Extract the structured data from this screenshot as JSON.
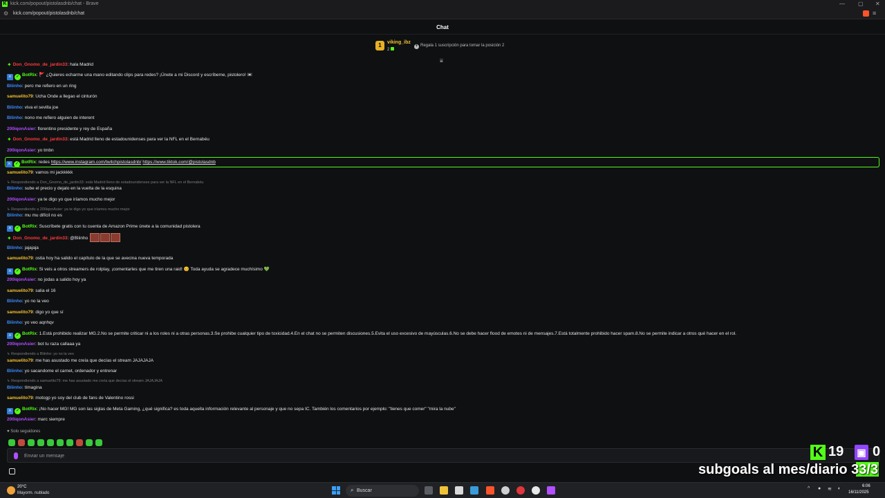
{
  "browser": {
    "title": "kick.com/popout/pistolasdnb/chat - Brave",
    "url": "kick.com/popout/pistolasdnb/chat"
  },
  "header": {
    "title": "Chat"
  },
  "pinned": {
    "rank": "1",
    "gifter_name": "viking_ibz",
    "gifter_count": "2",
    "gift_prompt": "Regala 1 suscripción para tomar la posición 2"
  },
  "colors": {
    "kick_green": "#53fc18",
    "highlight_border": "#53fc18",
    "user_green": "#53fc18",
    "user_blue": "#3d8bff",
    "user_yellow": "#f1c232",
    "user_purple": "#b24fff",
    "user_red": "#ff3b3b"
  },
  "messages": [
    {
      "user": "Don_Gnomo_de_jardin33",
      "text": ": hala Madrid"
    },
    {
      "user": "BotRix",
      "text": ": 🚩 ¿Quieres echarme una mano editando clips para redes? ¡Únete a mi Discord y escríbeme, pistolero! 📼"
    },
    {
      "user": "Bliinho",
      "text": ": pero me refiero en un ring"
    },
    {
      "user": "samuelito79",
      "text": ": Ucha Onde a llegao el cinturón"
    },
    {
      "user": "Bliinho",
      "text": ": viva el sevilla joe"
    },
    {
      "user": "Bliinho",
      "text": ": nono me refiero alguien de interent"
    },
    {
      "user": "200iqonAsier",
      "text": ": florentino presidente y rey de España"
    },
    {
      "user": "Don_Gnomo_de_jardin33",
      "text": ": está Madrid lleno de estadounidenses para ver la NFL en el Bernabéu"
    },
    {
      "user": "200iqonAsier",
      "text": ": yo tmbn"
    },
    {
      "user": "BotRix",
      "text": ": redes ",
      "link1": "https://www.instagram.com/twitchpistolasdnb/",
      "link2": "https://www.tiktok.com/@pistolasdnb"
    },
    {
      "user": "samuelito79",
      "text": ": vamos mi jackkkkk"
    },
    {
      "reply": "Respondiendo a Don_Gnomo_de_jardin33: está Madrid lleno de estadounidenses para ver la NFL en el Bernabéu"
    },
    {
      "user": "Bliinho",
      "text": ": sube el precio y dejalo en la vuelta de la esquina"
    },
    {
      "user": "200iqonAsier",
      "text": ": ya te digo yo que iríamos mucho mejor"
    },
    {
      "reply": "Respondiendo a 200iqonAsier: ya te digo yo que iríamos mucho mejor"
    },
    {
      "user": "Bliinho",
      "text": ": mu mu difícil no es"
    },
    {
      "user": "BotRix",
      "text": ": Suscríbete gratis con tu cuenta de Amazon Prime únete a la comunidad pistolera"
    },
    {
      "user": "Don_Gnomo_de_jardin33",
      "text": ": @Bliinho"
    },
    {
      "user": "Bliinho",
      "text": ": jajajaja"
    },
    {
      "user": "samuelito79",
      "text": ": ostia hoy ha salido el capítulo de la que se avecina nueva temporada"
    },
    {
      "user": "BotRix",
      "text": ": Si veis a otros streamers de rolplay, ¡comentarles que me tiren una raid! 😊 Toda ayuda se agradece muchísimo 💚"
    },
    {
      "user": "200iqonAsier",
      "text": ": no jodas a salido hoy ya"
    },
    {
      "user": "samuelito79",
      "text": ": salia el 16"
    },
    {
      "user": "Bliinho",
      "text": ": yo no la veo"
    },
    {
      "user": "samuelito79",
      "text": ": digo yo que sí"
    },
    {
      "user": "Bliinho",
      "text": ": yo veo aqnhqv"
    },
    {
      "user": "BotRix",
      "text": ": 1.Está prohibido realizar MG.2.No se permite criticar ni a los roles ni a otras personas.3.Se prohibe cualquier tipo de toxicidad.4.En el chat no se permiten discusiones.5.Evita el uso excesivo de mayúsculas.6.No se debe hacer flood de emotes ni de mensajes.7.Está totalmente prohibido hacer spam.8.No se permite indicar a otros qué hacer en el rol."
    },
    {
      "user": "200iqonAsier",
      "text": ": bot tu raza callaaa ya"
    },
    {
      "reply": "Respondiendo a Bliinho: yo no la veo"
    },
    {
      "user": "samuelito79",
      "text": ": me has asustado me creía que decías el stream JAJAJAJA"
    },
    {
      "user": "Bliinho",
      "text": ": yo sacandome el carnet, ordenador y entrenar"
    },
    {
      "reply": "Respondiendo a samuelito79: me has asustado me creía que decías el stream JAJAJAJA"
    },
    {
      "user": "Bliinho",
      "text": ": tímagina"
    },
    {
      "user": "samuelito79",
      "text": ": motogp yo soy del club de fans de Valentino rossi"
    },
    {
      "user": "BotRix",
      "text": ": ¡No hacer MG! MG son las siglas de Meta Gaming, ¿qué significa? es toda aquella información relevante al personaje y que no sepa IC. También los comentarios por ejemplo: \"tienes que comer\" \"mira la nube\""
    },
    {
      "user": "200iqonAsier",
      "text": ": marc siempre"
    }
  ],
  "footer": {
    "followers_only": "Solo seguidores",
    "input_placeholder": "Enviar un mensaje"
  },
  "overlay": {
    "kick_count": "19",
    "twitch_count": "0",
    "subgoals": "subgoals al mes/diario 33/3"
  },
  "taskbar": {
    "temp": "20°C",
    "weather": "Mayorm. nublado",
    "search_label": "Buscar",
    "time": "6:06",
    "date": "16/11/2025"
  }
}
